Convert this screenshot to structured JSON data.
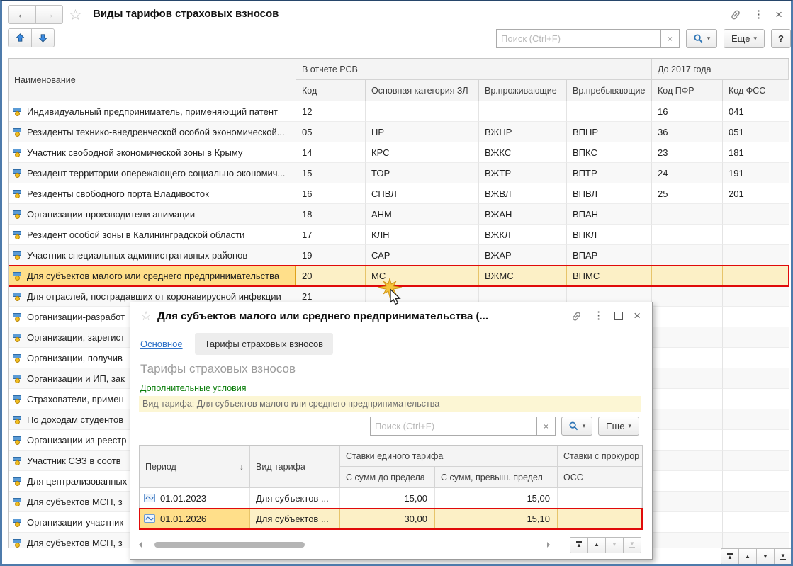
{
  "window": {
    "title": "Виды тарифов страховых взносов",
    "toolbar": {
      "search_placeholder": "Поиск (Ctrl+F)",
      "more_label": "Еще",
      "help_label": "?"
    }
  },
  "icons": {
    "back": "←",
    "forward": "→",
    "star": "☆",
    "dots": "⋮",
    "close": "×",
    "caret": "▾",
    "clear": "×",
    "sort_desc": "↓",
    "up": "▲",
    "down": "▼"
  },
  "main_table": {
    "headers": {
      "name": "Наименование",
      "group_rsv": "В отчете РСВ",
      "group_before2017": "До 2017 года",
      "sub": [
        "Код",
        "Основная категория ЗЛ",
        "Вр.проживающие",
        "Вр.пребывающие",
        "Код ПФР",
        "Код ФСС"
      ]
    },
    "rows": [
      {
        "name": "Индивидуальный предприниматель, применяющий патент",
        "kod": "12",
        "kat": "",
        "prozh": "",
        "preb": "",
        "pfr": "16",
        "fss": "041",
        "selected": false
      },
      {
        "name": "Резиденты технико-внедренческой особой экономической...",
        "kod": "05",
        "kat": "НР",
        "prozh": "ВЖНР",
        "preb": "ВПНР",
        "pfr": "36",
        "fss": "051",
        "selected": false
      },
      {
        "name": "Участник свободной экономической зоны в Крыму",
        "kod": "14",
        "kat": "КРС",
        "prozh": "ВЖКС",
        "preb": "ВПКС",
        "pfr": "23",
        "fss": "181",
        "selected": false
      },
      {
        "name": "Резидент территории опережающего социально-экономич...",
        "kod": "15",
        "kat": "ТОР",
        "prozh": "ВЖТР",
        "preb": "ВПТР",
        "pfr": "24",
        "fss": "191",
        "selected": false
      },
      {
        "name": "Резиденты свободного порта Владивосток",
        "kod": "16",
        "kat": "СПВЛ",
        "prozh": "ВЖВЛ",
        "preb": "ВПВЛ",
        "pfr": "25",
        "fss": "201",
        "selected": false
      },
      {
        "name": "Организации-производители анимации",
        "kod": "18",
        "kat": "АНМ",
        "prozh": "ВЖАН",
        "preb": "ВПАН",
        "pfr": "",
        "fss": "",
        "selected": false
      },
      {
        "name": "Резидент особой зоны в Калининградской области",
        "kod": "17",
        "kat": "КЛН",
        "prozh": "ВЖКЛ",
        "preb": "ВПКЛ",
        "pfr": "",
        "fss": "",
        "selected": false
      },
      {
        "name": "Участник специальных административных районов",
        "kod": "19",
        "kat": "САР",
        "prozh": "ВЖАР",
        "preb": "ВПАР",
        "pfr": "",
        "fss": "",
        "selected": false
      },
      {
        "name": "Для субъектов малого или среднего предпринимательства",
        "kod": "20",
        "kat": "МС",
        "prozh": "ВЖМС",
        "preb": "ВПМС",
        "pfr": "",
        "fss": "",
        "selected": true
      },
      {
        "name": "Для отраслей, пострадавших от коронавирусной инфекции",
        "kod": "21",
        "kat": "",
        "prozh": "",
        "preb": "",
        "pfr": "",
        "fss": "",
        "selected": false
      },
      {
        "name": "Организации-разработ",
        "kod": "",
        "kat": "",
        "prozh": "",
        "preb": "",
        "pfr": "",
        "fss": "",
        "selected": false
      },
      {
        "name": "Организации, зарегист",
        "kod": "",
        "kat": "",
        "prozh": "",
        "preb": "",
        "pfr": "",
        "fss": "",
        "selected": false
      },
      {
        "name": "Организации, получив",
        "kod": "",
        "kat": "",
        "prozh": "",
        "preb": "",
        "pfr": "",
        "fss": "",
        "selected": false
      },
      {
        "name": "Организации и ИП, зак",
        "kod": "",
        "kat": "",
        "prozh": "",
        "preb": "",
        "pfr": "",
        "fss": "",
        "selected": false
      },
      {
        "name": "Страхователи, примен",
        "kod": "",
        "kat": "",
        "prozh": "",
        "preb": "",
        "pfr": "",
        "fss": "",
        "selected": false
      },
      {
        "name": "По доходам студентов",
        "kod": "",
        "kat": "",
        "prozh": "",
        "preb": "",
        "pfr": "",
        "fss": "",
        "selected": false
      },
      {
        "name": "Организации из реестр",
        "kod": "",
        "kat": "",
        "prozh": "",
        "preb": "",
        "pfr": "",
        "fss": "",
        "selected": false
      },
      {
        "name": "Участник СЭЗ в соотв",
        "kod": "",
        "kat": "",
        "prozh": "",
        "preb": "",
        "pfr": "",
        "fss": "",
        "selected": false
      },
      {
        "name": "Для централизованных",
        "kod": "",
        "kat": "",
        "prozh": "",
        "preb": "",
        "pfr": "",
        "fss": "",
        "selected": false
      },
      {
        "name": "Для субъектов МСП, з",
        "kod": "",
        "kat": "",
        "prozh": "",
        "preb": "",
        "pfr": "",
        "fss": "",
        "selected": false
      },
      {
        "name": "Организации-участник",
        "kod": "",
        "kat": "",
        "prozh": "",
        "preb": "",
        "pfr": "",
        "fss": "",
        "selected": false
      },
      {
        "name": "Для субъектов МСП, з",
        "kod": "",
        "kat": "",
        "prozh": "",
        "preb": "",
        "pfr": "",
        "fss": "",
        "selected": false
      }
    ]
  },
  "popup": {
    "title": "Для субъектов малого или среднего предпринимательства (...",
    "tab_main": "Основное",
    "tab_tariffs": "Тарифы страховых взносов",
    "heading": "Тарифы страховых взносов",
    "conditions_link": "Дополнительные условия",
    "filter_text": "Вид тарифа: Для субъектов малого или среднего предпринимательства",
    "search_placeholder": "Поиск (Ctrl+F)",
    "more_label": "Еще",
    "table": {
      "col_period": "Период",
      "col_tariff": "Вид тарифа",
      "group_unified": "Ставки единого тарифа",
      "group_prosecutor": "Ставки с прокурор",
      "sub_below_limit": "С сумм до предела",
      "sub_above_limit": "С сумм, превыш. предел",
      "sub_oss": "ОСС",
      "rows": [
        {
          "period": "01.01.2023",
          "tariff": "Для субъектов ...",
          "below": "15,00",
          "above": "15,00",
          "oss": "",
          "selected": false
        },
        {
          "period": "01.01.2026",
          "tariff": "Для субъектов ...",
          "below": "30,00",
          "above": "15,10",
          "oss": "",
          "selected": true
        }
      ]
    }
  },
  "colors": {
    "selection_fill": "#fcf0c6",
    "current_cell": "#ffdf8a",
    "highlight_border": "#e00a0a",
    "link_blue": "#2e71c8",
    "link_green": "#0a7d0a",
    "filter_bar_bg": "#fcf6d4"
  }
}
